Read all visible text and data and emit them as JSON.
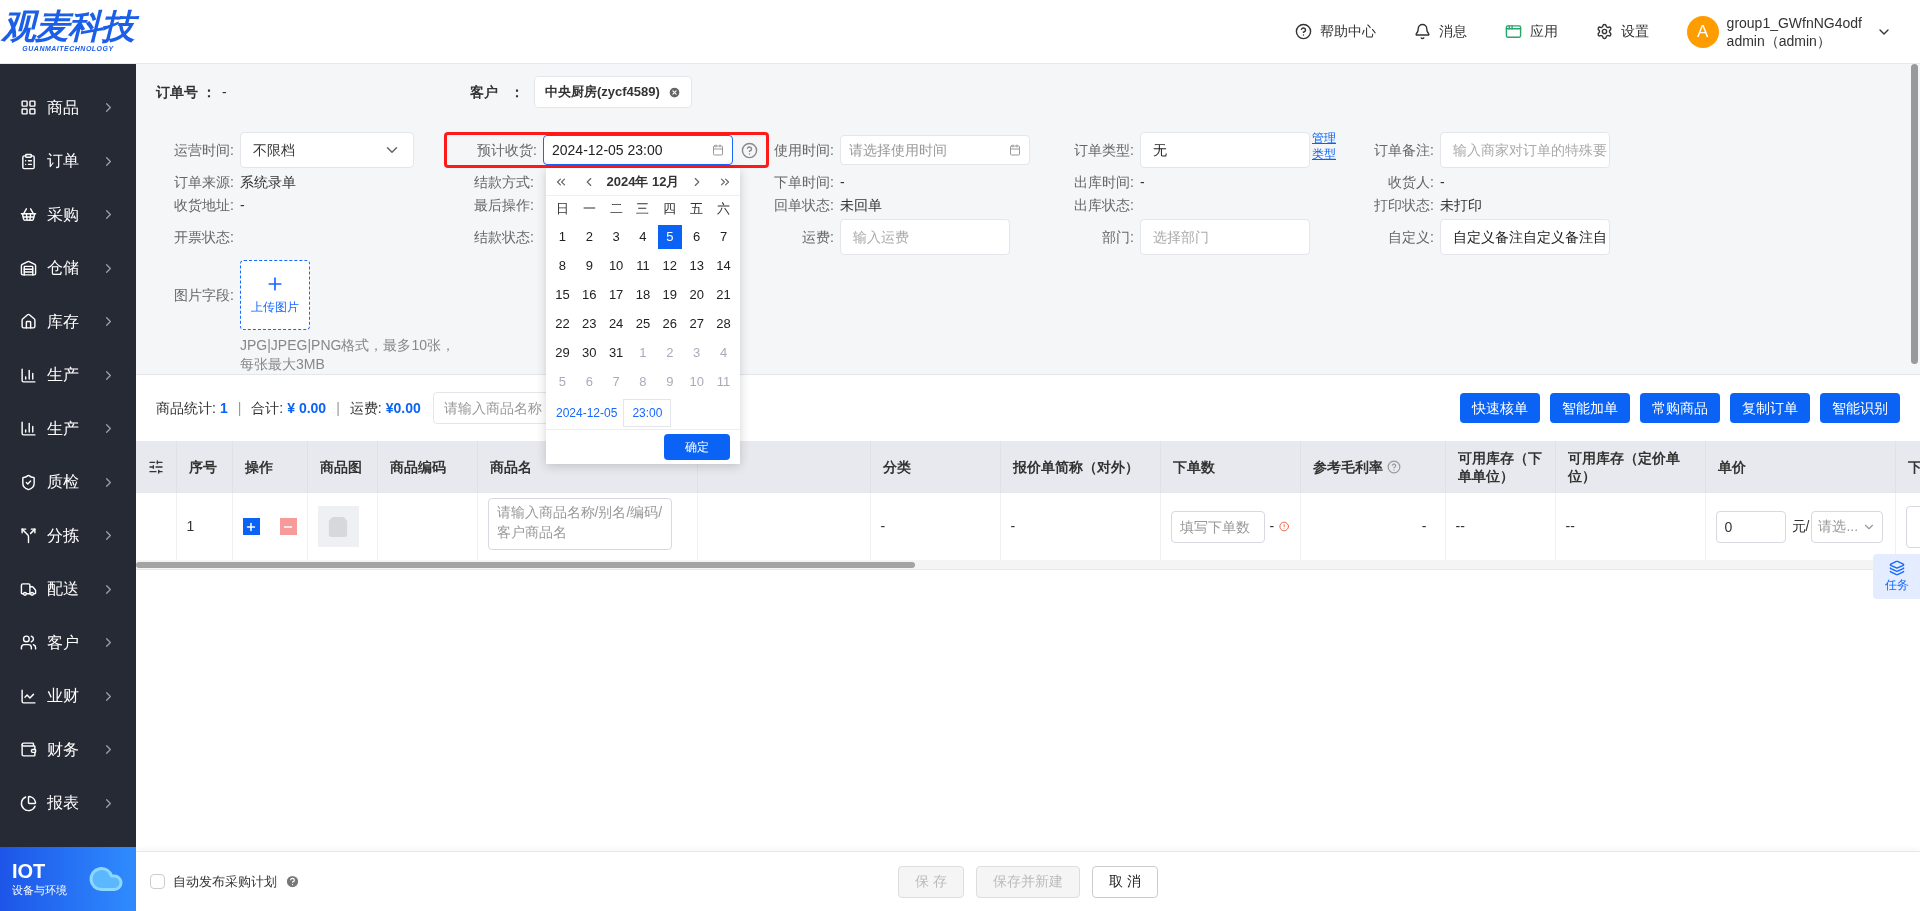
{
  "logo": {
    "title": "观麦科技",
    "subtitle": "GUANMAITECHNOLOGY"
  },
  "header": {
    "links": [
      {
        "kind": "help",
        "label": "帮助中心"
      },
      {
        "kind": "bell",
        "label": "消息"
      },
      {
        "kind": "app",
        "label": "应用"
      },
      {
        "kind": "gear",
        "label": "设置"
      }
    ],
    "user": {
      "avatar": "A",
      "name": "group1_GWfnNG4odf",
      "role": "admin（admin）"
    }
  },
  "sidebar": {
    "items": [
      {
        "kind": "goods",
        "label": "商品"
      },
      {
        "kind": "order",
        "label": "订单"
      },
      {
        "kind": "purchase",
        "label": "采购"
      },
      {
        "kind": "storage",
        "label": "仓储"
      },
      {
        "kind": "stock",
        "label": "库存"
      },
      {
        "kind": "production",
        "label": "生产"
      },
      {
        "kind": "production",
        "label": "生产"
      },
      {
        "kind": "quality",
        "label": "质检"
      },
      {
        "kind": "sorting",
        "label": "分拣"
      },
      {
        "kind": "delivery",
        "label": "配送"
      },
      {
        "kind": "customer",
        "label": "客户"
      },
      {
        "kind": "business",
        "label": "业财"
      },
      {
        "kind": "finance",
        "label": "财务"
      },
      {
        "kind": "report",
        "label": "报表"
      }
    ],
    "banner": {
      "title": "IOT",
      "subtitle": "设备与环境"
    }
  },
  "form": {
    "order_no": {
      "label": "订单号",
      "colon": "：",
      "value": "-"
    },
    "customer": {
      "label": "客户",
      "colon": "：",
      "value": "中央厨房(zycf4589)"
    },
    "rows": [
      [
        {
          "kind": "select",
          "label": "运营时间:",
          "value": "不限档"
        },
        {
          "kind": "date",
          "label": "预计收货:",
          "value": "2024-12-05 23:00",
          "help": true,
          "highlighted": true
        },
        {
          "kind": "date",
          "label": "使用时间:",
          "placeholder": "请选择使用时间"
        },
        {
          "kind": "input",
          "label": "订单类型:",
          "value": "无",
          "link": "管理类型"
        },
        {
          "kind": "input",
          "label": "订单备注:",
          "placeholder": "输入商家对订单的特殊要"
        }
      ],
      [
        {
          "kind": "text",
          "label": "订单来源:",
          "value": "系统录单"
        },
        {
          "kind": "text",
          "label": "结款方式:"
        },
        {
          "kind": "text",
          "label": "下单时间:",
          "value": "-"
        },
        {
          "kind": "text",
          "label": "出库时间:",
          "value": "-"
        },
        {
          "kind": "text",
          "label": "收货人:",
          "value": "-"
        }
      ],
      [
        {
          "kind": "text",
          "label": "收货地址:",
          "value": "-"
        },
        {
          "kind": "text",
          "label": "最后操作:"
        },
        {
          "kind": "text",
          "label": "回单状态:",
          "value": "未回单"
        },
        {
          "kind": "text",
          "label": "出库状态:"
        },
        {
          "kind": "text",
          "label": "打印状态:",
          "value": "未打印"
        }
      ],
      [
        {
          "kind": "text",
          "label": "开票状态:"
        },
        {
          "kind": "text",
          "label": "结款状态:"
        },
        {
          "kind": "input",
          "label": "运费:",
          "placeholder": "输入运费"
        },
        {
          "kind": "input",
          "label": "部门:",
          "placeholder": "选择部门"
        },
        {
          "kind": "input",
          "label": "自定义:",
          "value": "自定义备注自定义备注自"
        }
      ],
      [
        {
          "kind": "upload",
          "label": "图片字段:",
          "button": "上传图片",
          "note": "JPG|JPEG|PNG格式，最多10张，每张最大3MB"
        }
      ]
    ]
  },
  "calendar": {
    "title": "2024年 12月",
    "weekdays": [
      "日",
      "一",
      "二",
      "三",
      "四",
      "五",
      "六"
    ],
    "days": [
      {
        "label": "1",
        "outside": false,
        "selected": false
      },
      {
        "label": "2",
        "outside": false,
        "selected": false
      },
      {
        "label": "3",
        "outside": false,
        "selected": false
      },
      {
        "label": "4",
        "outside": false,
        "selected": false
      },
      {
        "label": "5",
        "outside": false,
        "selected": true
      },
      {
        "label": "6",
        "outside": false,
        "selected": false
      },
      {
        "label": "7",
        "outside": false,
        "selected": false
      },
      {
        "label": "8",
        "outside": false,
        "selected": false
      },
      {
        "label": "9",
        "outside": false,
        "selected": false
      },
      {
        "label": "10",
        "outside": false,
        "selected": false
      },
      {
        "label": "11",
        "outside": false,
        "selected": false
      },
      {
        "label": "12",
        "outside": false,
        "selected": false
      },
      {
        "label": "13",
        "outside": false,
        "selected": false
      },
      {
        "label": "14",
        "outside": false,
        "selected": false
      },
      {
        "label": "15",
        "outside": false,
        "selected": false
      },
      {
        "label": "16",
        "outside": false,
        "selected": false
      },
      {
        "label": "17",
        "outside": false,
        "selected": false
      },
      {
        "label": "18",
        "outside": false,
        "selected": false
      },
      {
        "label": "19",
        "outside": false,
        "selected": false
      },
      {
        "label": "20",
        "outside": false,
        "selected": false
      },
      {
        "label": "21",
        "outside": false,
        "selected": false
      },
      {
        "label": "22",
        "outside": false,
        "selected": false
      },
      {
        "label": "23",
        "outside": false,
        "selected": false
      },
      {
        "label": "24",
        "outside": false,
        "selected": false
      },
      {
        "label": "25",
        "outside": false,
        "selected": false
      },
      {
        "label": "26",
        "outside": false,
        "selected": false
      },
      {
        "label": "27",
        "outside": false,
        "selected": false
      },
      {
        "label": "28",
        "outside": false,
        "selected": false
      },
      {
        "label": "29",
        "outside": false,
        "selected": false
      },
      {
        "label": "30",
        "outside": false,
        "selected": false
      },
      {
        "label": "31",
        "outside": false,
        "selected": false
      },
      {
        "label": "1",
        "outside": true,
        "selected": false
      },
      {
        "label": "2",
        "outside": true,
        "selected": false
      },
      {
        "label": "3",
        "outside": true,
        "selected": false
      },
      {
        "label": "4",
        "outside": true,
        "selected": false
      },
      {
        "label": "5",
        "outside": true,
        "selected": false
      },
      {
        "label": "6",
        "outside": true,
        "selected": false
      },
      {
        "label": "7",
        "outside": true,
        "selected": false
      },
      {
        "label": "8",
        "outside": true,
        "selected": false
      },
      {
        "label": "9",
        "outside": true,
        "selected": false
      },
      {
        "label": "10",
        "outside": true,
        "selected": false
      },
      {
        "label": "11",
        "outside": true,
        "selected": false
      }
    ],
    "date": "2024-12-05",
    "time": "23:00",
    "confirm": "确定"
  },
  "toolbar": {
    "stats": [
      {
        "label": "商品统计:",
        "value": "1"
      },
      {
        "label": "合计:",
        "value": "¥ 0.00"
      },
      {
        "label": "运费:",
        "value": "¥0.00"
      }
    ],
    "separators": [
      "|",
      "|"
    ],
    "search": {
      "placeholder": "请输入商品名称"
    },
    "buttons": [
      "快速核单",
      "智能加单",
      "常购商品",
      "复制订单",
      "智能识别"
    ]
  },
  "table": {
    "columns": [
      {
        "kind": "settings"
      },
      {
        "label": "序号"
      },
      {
        "label": "操作"
      },
      {
        "label": "商品图"
      },
      {
        "label": "商品编码"
      },
      {
        "label": "商品名"
      },
      {
        "kind": "blank"
      },
      {
        "label": "分类"
      },
      {
        "label": "报价单简称（对外）"
      },
      {
        "label": "下单数"
      },
      {
        "label": "参考毛利率",
        "help": true
      },
      {
        "label": "可用库存（下单单位）"
      },
      {
        "label": "可用库存（定价单位）"
      },
      {
        "label": "单价"
      },
      {
        "label": "下"
      }
    ],
    "rows": [
      {
        "cells": [
          {
            "kind": "empty"
          },
          {
            "kind": "text",
            "value": "1"
          },
          {
            "kind": "actions"
          },
          {
            "kind": "image"
          },
          {
            "kind": "empty"
          },
          {
            "kind": "input",
            "placeholder": "请输入商品名称/别名/编码/客户商品名"
          },
          {
            "kind": "empty"
          },
          {
            "kind": "text",
            "value": "-"
          },
          {
            "kind": "text",
            "value": "-"
          },
          {
            "kind": "qty",
            "placeholder": "填写下单数",
            "suffix": "-"
          },
          {
            "kind": "number",
            "value": "-"
          },
          {
            "kind": "text",
            "value": "--"
          },
          {
            "kind": "text",
            "value": "--"
          },
          {
            "kind": "price",
            "value": "0",
            "unit": "元/",
            "placeholder": "请选..."
          },
          {
            "kind": "cut"
          }
        ]
      }
    ]
  },
  "task": {
    "label": "任务"
  },
  "footer": {
    "checkbox": {
      "label": "自动发布采购计划",
      "checked": false
    },
    "buttons": [
      {
        "label": "保 存",
        "disabled": true
      },
      {
        "label": "保存并新建",
        "disabled": true
      },
      {
        "label": "取 消",
        "disabled": false
      }
    ]
  }
}
